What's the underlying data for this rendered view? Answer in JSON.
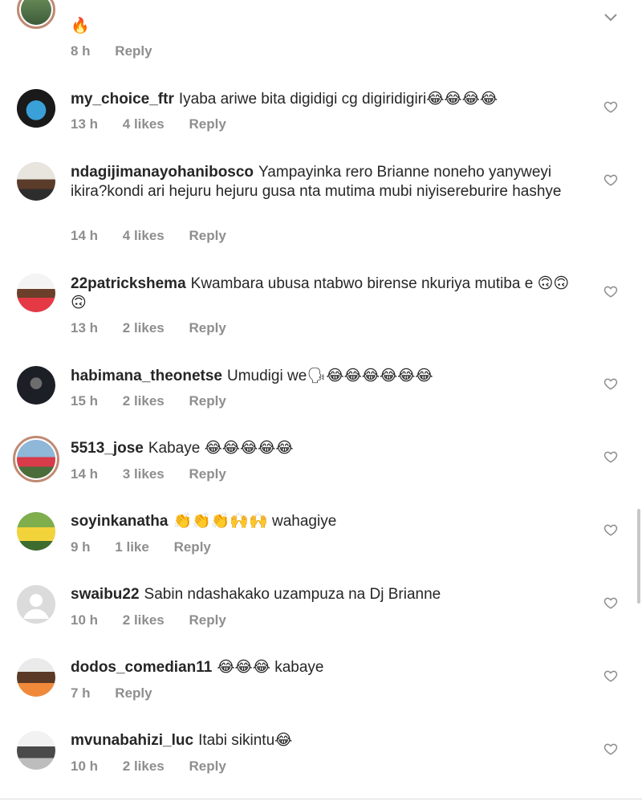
{
  "top_comment": {
    "text": "🔥",
    "time": "8 h",
    "reply": "Reply"
  },
  "comments": [
    {
      "username": "my_choice_ftr",
      "text": "Iyaba ariwe bita digidigi cg digiridigiri😂😂😂😂",
      "time": "13 h",
      "likes": "4 likes",
      "reply": "Reply"
    },
    {
      "username": "ndagijimanayohanibosco",
      "text": "Yampayinka rero Brianne noneho yanyweyi ikira?kondi ari hejuru hejuru gusa nta mutima mubi niyisereburire hashye",
      "time": "14 h",
      "likes": "4 likes",
      "reply": "Reply"
    },
    {
      "username": "22patrickshema",
      "text": "Kwambara ubusa ntabwo birense nkuriya mutiba e 🙃🙃🙃",
      "time": "13 h",
      "likes": "2 likes",
      "reply": "Reply"
    },
    {
      "username": "habimana_theonetse",
      "text": "Umudigi we🗣😂😂😂😂😂😂",
      "time": "15 h",
      "likes": "2 likes",
      "reply": "Reply"
    },
    {
      "username": "5513_jose",
      "text": "Kabaye 😂😂😂😂😂",
      "time": "14 h",
      "likes": "3 likes",
      "reply": "Reply"
    },
    {
      "username": "soyinkanatha",
      "text": "👏👏👏🙌🙌 wahagiye",
      "time": "9 h",
      "likes": "1 like",
      "reply": "Reply"
    },
    {
      "username": "swaibu22",
      "text": "Sabin ndashakako uzampuza na Dj Brianne",
      "time": "10 h",
      "likes": "2 likes",
      "reply": "Reply"
    },
    {
      "username": "dodos_comedian11",
      "text": "😂😂😂 kabaye",
      "time": "7 h",
      "likes": "",
      "reply": "Reply"
    },
    {
      "username": "mvunabahizi_luc",
      "text": "Itabi sikintu😂",
      "time": "10 h",
      "likes": "2 likes",
      "reply": "Reply"
    }
  ],
  "icons": {
    "heart": "heart-outline-icon",
    "chevron": "chevron-down-icon"
  },
  "colors": {
    "text": "#262626",
    "meta": "#8e8e8e",
    "story_ring": "#c08a74"
  }
}
